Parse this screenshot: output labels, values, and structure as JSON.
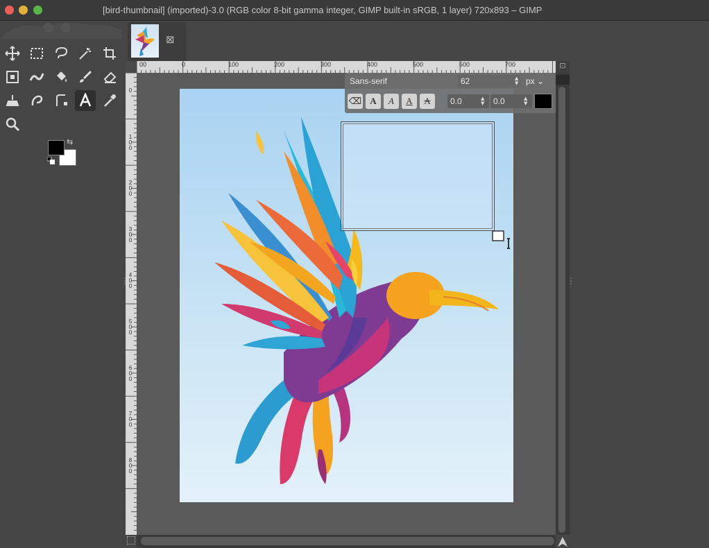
{
  "window": {
    "title": "[bird-thumbnail] (imported)-3.0 (RGB color 8-bit gamma integer, GIMP built-in sRGB, 1 layer) 720x893 – GIMP"
  },
  "toolbox": {
    "tools": [
      {
        "name": "move-icon"
      },
      {
        "name": "rectangle-select-icon"
      },
      {
        "name": "free-select-icon"
      },
      {
        "name": "fuzzy-select-icon"
      },
      {
        "name": "crop-icon"
      },
      {
        "name": "unified-transform-icon"
      },
      {
        "name": "warp-transform-icon"
      },
      {
        "name": "bucket-fill-icon"
      },
      {
        "name": "paintbrush-icon"
      },
      {
        "name": "eraser-icon"
      },
      {
        "name": "clone-icon"
      },
      {
        "name": "smudge-icon"
      },
      {
        "name": "paths-icon"
      },
      {
        "name": "text-icon"
      },
      {
        "name": "color-picker-icon"
      },
      {
        "name": "zoom-icon"
      }
    ],
    "active_tool": "text-icon",
    "foreground_color": "#000000",
    "background_color": "#ffffff"
  },
  "image_tab": {
    "close_label": "⊠"
  },
  "ruler": {
    "h_labels": [
      "00",
      "0",
      "100",
      "200",
      "300",
      "400",
      "500",
      "600",
      "700"
    ],
    "v_labels": [
      "0",
      "100",
      "200",
      "300",
      "400",
      "500",
      "600",
      "700",
      "800"
    ]
  },
  "text_tool_overlay": {
    "font": "Sans-serif",
    "size": "62",
    "unit": "px",
    "style_buttons": [
      "⌫",
      "A",
      "A",
      "A",
      "A"
    ],
    "baseline": "0.0",
    "kerning": "0.0",
    "color": "#000000"
  },
  "colors": {
    "background": "#454545",
    "titlebar": "#3a3a3a",
    "ruler": "#d8d8d8",
    "canvas_sky_top": "#a9d3f2",
    "canvas_sky_bottom": "#e3f1f9"
  }
}
